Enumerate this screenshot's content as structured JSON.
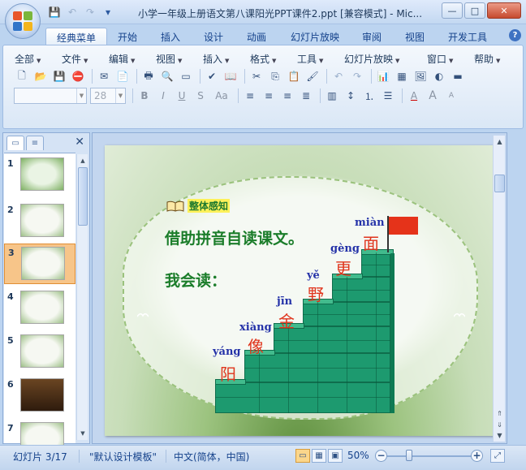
{
  "window": {
    "title": "小学一年级上册语文第八课阳光PPT课件2.ppt [兼容模式] - Mic...",
    "buttons": {
      "minimize": "—",
      "maximize": "□",
      "close": "✕"
    }
  },
  "quick_access": {
    "save": "💾",
    "undo": "↶",
    "redo": "↷",
    "customize": "▾"
  },
  "ribbon_tabs": [
    "经典菜单",
    "开始",
    "插入",
    "设计",
    "动画",
    "幻灯片放映",
    "审阅",
    "视图",
    "开发工具"
  ],
  "help_label": "?",
  "classic_menu": [
    "全部",
    "文件",
    "编辑",
    "视图",
    "插入",
    "格式",
    "工具",
    "幻灯片放映",
    "窗口",
    "帮助"
  ],
  "format_bar": {
    "font_placeholder": "",
    "font_size": "28",
    "bold": "B",
    "italic": "I",
    "underline": "U",
    "strike": "S",
    "case": "Aa",
    "font_color": "A",
    "grow": "A",
    "shrink": "A"
  },
  "slide_panel": {
    "tab_slides_icon": "slides-tab-icon",
    "tab_outline_icon": "outline-tab-icon",
    "close": "✕",
    "slide_numbers": [
      "1",
      "2",
      "3",
      "4",
      "5",
      "6",
      "7"
    ],
    "selected": 3
  },
  "slide": {
    "heading": "整体感知",
    "line1": "借助拼音自读课文。",
    "line2": "我会读：",
    "steps": [
      {
        "pinyin": "yáng",
        "hanzi": "阳"
      },
      {
        "pinyin": "xiàng",
        "hanzi": "像"
      },
      {
        "pinyin": "jīn",
        "hanzi": "金"
      },
      {
        "pinyin": "yě",
        "hanzi": "野"
      },
      {
        "pinyin": "gèng",
        "hanzi": "更"
      },
      {
        "pinyin": "miàn",
        "hanzi": "面"
      }
    ],
    "colors": {
      "step": "#1d9a6f",
      "flag": "#e5331a",
      "pinyin": "#2432a8",
      "hanzi": "#e0341c",
      "text": "#1b7d2a"
    }
  },
  "status": {
    "slide_info": "幻灯片 3/17",
    "template": "\"默认设计模板\"",
    "language": "中文(简体，中国)",
    "zoom": "50%",
    "zoom_value": 50
  }
}
